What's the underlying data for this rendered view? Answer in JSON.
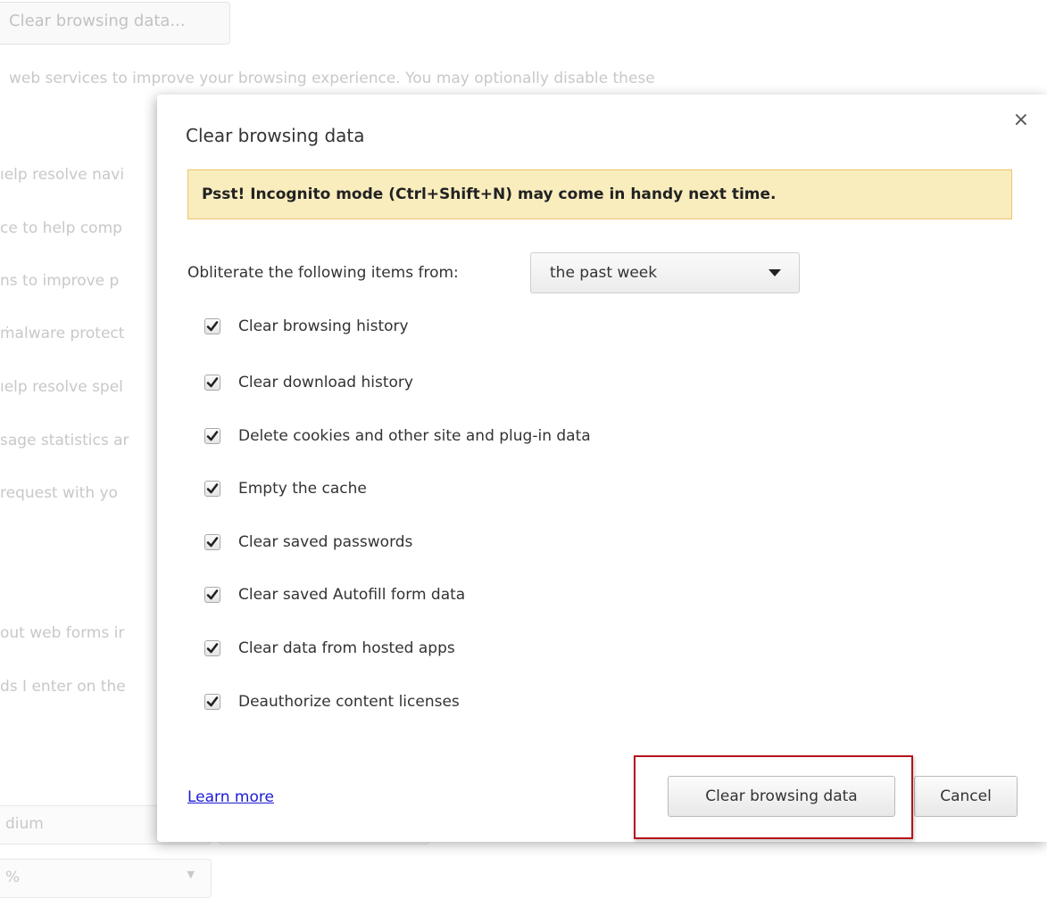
{
  "background": {
    "clear_button_label": "Clear browsing data...",
    "intro_line": "web services to improve your browsing experience. You may optionally disable these",
    "lines": [
      "ıelp resolve navi",
      "ce to help comp",
      "ns to improve p",
      "ṁalware protect",
      "ıelp resolve spel",
      "sage statistics ar",
      "request with yo",
      "out web forms ir",
      "ds I enter on the"
    ],
    "font_size_value": "dium",
    "zoom_value": "%"
  },
  "dialog": {
    "title": "Clear browsing data",
    "close_icon": "×",
    "banner": "Psst! Incognito mode (Ctrl+Shift+N) may come in handy next time.",
    "range_label": "Obliterate the following items from:",
    "range_value": "the past week",
    "options": [
      {
        "label": "Clear browsing history",
        "checked": true
      },
      {
        "label": "Clear download history",
        "checked": true
      },
      {
        "label": "Delete cookies and other site and plug-in data",
        "checked": true
      },
      {
        "label": "Empty the cache",
        "checked": true
      },
      {
        "label": "Clear saved passwords",
        "checked": true
      },
      {
        "label": "Clear saved Autofill form data",
        "checked": true
      },
      {
        "label": "Clear data from hosted apps",
        "checked": true
      },
      {
        "label": "Deauthorize content licenses",
        "checked": true
      }
    ],
    "learn_more": "Learn more",
    "clear_button": "Clear browsing data",
    "cancel_button": "Cancel"
  },
  "colors": {
    "banner_bg": "#f9edbe",
    "banner_border": "#f0c36d",
    "link": "#1a1ad6",
    "highlight": "#b5121b"
  }
}
